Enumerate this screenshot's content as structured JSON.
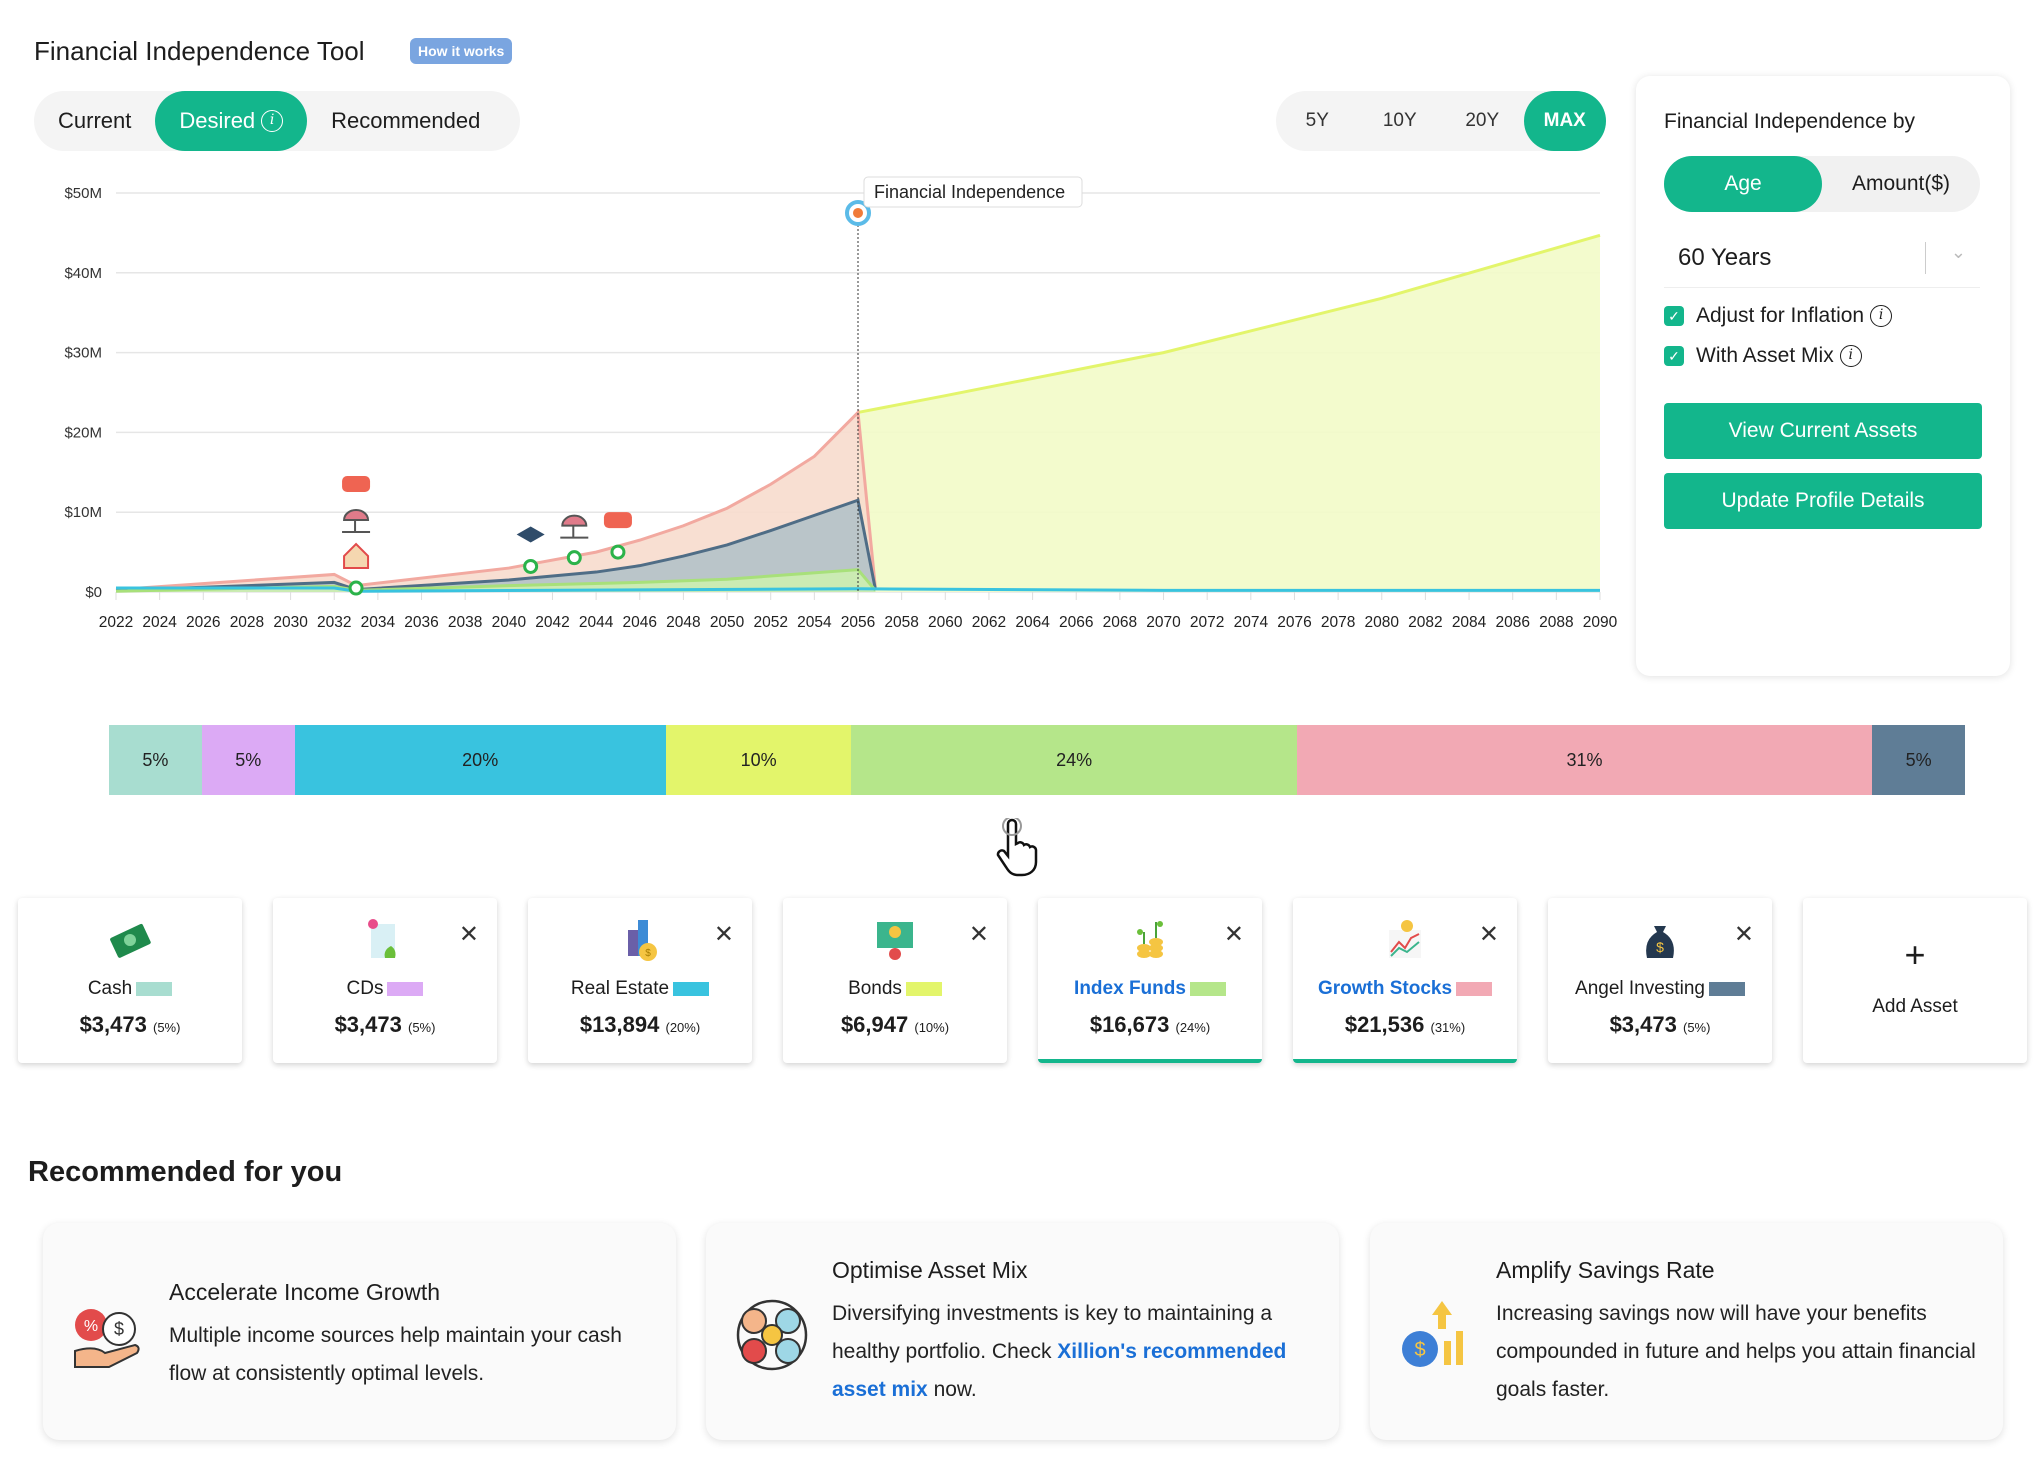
{
  "header": {
    "title": "Financial Independence Tool",
    "how_it_works": "How it works"
  },
  "view_tabs": [
    {
      "label": "Current",
      "active": false
    },
    {
      "label": "Desired",
      "active": true
    },
    {
      "label": "Recommended",
      "active": false
    }
  ],
  "periods": [
    {
      "label": "5Y",
      "active": false
    },
    {
      "label": "10Y",
      "active": false
    },
    {
      "label": "20Y",
      "active": false
    },
    {
      "label": "MAX",
      "active": true
    }
  ],
  "panel": {
    "title": "Financial Independence by",
    "modes": [
      {
        "label": "Age",
        "active": true
      },
      {
        "label": "Amount($)",
        "active": false
      }
    ],
    "selected": "60 Years",
    "checks": [
      {
        "label": "Adjust for Inflation",
        "checked": true
      },
      {
        "label": "With Asset Mix",
        "checked": true
      }
    ],
    "buttons": {
      "view": "View Current Assets",
      "update": "Update Profile Details"
    }
  },
  "accent": "#13b68c",
  "chart_data": {
    "type": "area",
    "x_ticks": [
      2022,
      2024,
      2026,
      2028,
      2030,
      2032,
      2034,
      2036,
      2038,
      2040,
      2042,
      2044,
      2046,
      2048,
      2050,
      2052,
      2054,
      2056,
      2058,
      2060,
      2062,
      2064,
      2066,
      2068,
      2070,
      2072,
      2074,
      2076,
      2078,
      2080,
      2082,
      2084,
      2086,
      2088,
      2090
    ],
    "y_ticks": [
      "$0",
      "$10M",
      "$20M",
      "$30M",
      "$40M",
      "$50M"
    ],
    "ylim": [
      0,
      50
    ],
    "annotation": {
      "label": "Financial Independence",
      "x": 2056
    },
    "series": [
      {
        "color": "#f2a9a0",
        "fill": "#f7dccd",
        "points": [
          [
            2022,
            0.3
          ],
          [
            2032,
            2.2
          ],
          [
            2033,
            0.8
          ],
          [
            2040,
            3
          ],
          [
            2044,
            5
          ],
          [
            2046,
            6.5
          ],
          [
            2048,
            8.3
          ],
          [
            2050,
            10.5
          ],
          [
            2052,
            13.5
          ],
          [
            2054,
            17
          ],
          [
            2056,
            22.5
          ],
          [
            2056.8,
            0.4
          ]
        ]
      },
      {
        "color": "#4f6d86",
        "fill": "#b3c2c8",
        "points": [
          [
            2022,
            0.2
          ],
          [
            2032,
            1.2
          ],
          [
            2033,
            0.3
          ],
          [
            2040,
            1.5
          ],
          [
            2044,
            2.5
          ],
          [
            2046,
            3.3
          ],
          [
            2048,
            4.5
          ],
          [
            2050,
            5.9
          ],
          [
            2052,
            7.7
          ],
          [
            2054,
            9.6
          ],
          [
            2056,
            11.5
          ],
          [
            2056.8,
            0.3
          ]
        ]
      },
      {
        "color": "#a8e07a",
        "fill": "#cdeeb0",
        "points": [
          [
            2022,
            0.1
          ],
          [
            2032,
            0.7
          ],
          [
            2033,
            0.2
          ],
          [
            2040,
            0.8
          ],
          [
            2046,
            1.2
          ],
          [
            2050,
            1.6
          ],
          [
            2056,
            2.8
          ],
          [
            2056.8,
            0.2
          ]
        ]
      },
      {
        "color": "#e3f56b",
        "fill": "#f2fbc8",
        "points": [
          [
            2056,
            22.5
          ],
          [
            2060,
            24.6
          ],
          [
            2070,
            30
          ],
          [
            2080,
            36.8
          ],
          [
            2090,
            44.7
          ]
        ]
      },
      {
        "color": "#39c3df",
        "fill": "none",
        "points": [
          [
            2022,
            0.5
          ],
          [
            2032,
            0.5
          ],
          [
            2033,
            0.1
          ],
          [
            2056,
            0.4
          ],
          [
            2070,
            0.2
          ],
          [
            2090,
            0.2
          ]
        ]
      }
    ],
    "milestones": [
      {
        "x": 2033,
        "y": 0.5,
        "icons": [
          "house",
          "beach",
          "car"
        ]
      },
      {
        "x": 2041,
        "y": 3.2,
        "icons": [
          "graduation"
        ]
      },
      {
        "x": 2043,
        "y": 4.3,
        "icons": [
          "beach"
        ]
      },
      {
        "x": 2045,
        "y": 5,
        "icons": [
          "car"
        ]
      }
    ]
  },
  "allocation": [
    {
      "label": "5%",
      "value": 5,
      "color": "#a8ddd0"
    },
    {
      "label": "5%",
      "value": 5,
      "color": "#dcaaf5"
    },
    {
      "label": "20%",
      "value": 20,
      "color": "#39c3df"
    },
    {
      "label": "10%",
      "value": 10,
      "color": "#e3f56b"
    },
    {
      "label": "24%",
      "value": 24,
      "color": "#b5e68a"
    },
    {
      "label": "31%",
      "value": 31,
      "color": "#f2a9b4"
    },
    {
      "label": "5%",
      "value": 5,
      "color": "#5f7d96"
    }
  ],
  "assets": [
    {
      "name": "Cash",
      "amount": "$3,473",
      "pct": "(5%)",
      "color": "#a8ddd0",
      "icon": "cash-icon",
      "removable": false,
      "selected": false
    },
    {
      "name": "CDs",
      "amount": "$3,473",
      "pct": "(5%)",
      "color": "#dcaaf5",
      "icon": "certificate-icon",
      "removable": true,
      "selected": false
    },
    {
      "name": "Real Estate",
      "amount": "$13,894",
      "pct": "(20%)",
      "color": "#39c3df",
      "icon": "building-icon",
      "removable": true,
      "selected": false
    },
    {
      "name": "Bonds",
      "amount": "$6,947",
      "pct": "(10%)",
      "color": "#e3f56b",
      "icon": "bond-icon",
      "removable": true,
      "selected": false
    },
    {
      "name": "Index Funds",
      "amount": "$16,673",
      "pct": "(24%)",
      "color": "#b5e68a",
      "icon": "coins-plant-icon",
      "removable": true,
      "selected": true
    },
    {
      "name": "Growth Stocks",
      "amount": "$21,536",
      "pct": "(31%)",
      "color": "#f2a9b4",
      "icon": "stock-chart-icon",
      "removable": true,
      "selected": true
    },
    {
      "name": "Angel Investing",
      "amount": "$3,473",
      "pct": "(5%)",
      "color": "#5f7d96",
      "icon": "money-bag-icon",
      "removable": true,
      "selected": false
    }
  ],
  "add_asset": {
    "label": "Add Asset",
    "icon": "+"
  },
  "recommended": {
    "heading": "Recommended for you",
    "cards": [
      {
        "title": "Accelerate Income Growth",
        "text": "Multiple income sources help maintain your cash flow at consistently optimal levels."
      },
      {
        "title": "Optimise Asset Mix",
        "text_before": "Diversifying investments is key to maintaining a healthy portfolio. Check ",
        "link": "Xillion's recommended asset mix",
        "text_after": " now."
      },
      {
        "title": "Amplify Savings Rate",
        "text": "Increasing savings now will have your benefits compounded in future and helps you attain financial goals faster."
      }
    ]
  }
}
